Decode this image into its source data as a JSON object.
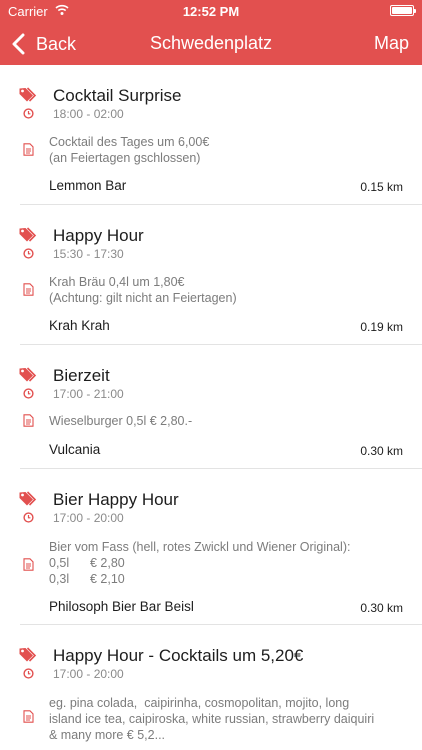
{
  "status_bar": {
    "carrier": "Carrier",
    "time": "12:52 PM"
  },
  "nav": {
    "back_label": "Back",
    "title": "Schwedenplatz",
    "map_label": "Map"
  },
  "colors": {
    "accent": "#e2504f",
    "icon": "#e2504f",
    "secondary_text": "#8a8a8a"
  },
  "icons": {
    "tag": "tag-icon",
    "clock": "clock-icon",
    "description": "document-icon",
    "back": "chevron-left-icon",
    "wifi": "wifi-icon",
    "battery": "battery-icon"
  },
  "deals": [
    {
      "name": "Cocktail Surprise",
      "time": "18:00 - 02:00",
      "description": [
        "Cocktail des Tages um 6,00€",
        "(an Feiertagen gschlossen)"
      ],
      "venue": "Lemmon Bar",
      "distance": "0.15 km"
    },
    {
      "name": "Happy Hour",
      "time": "15:30 - 17:30",
      "description": [
        "Krah Bräu 0,4l um 1,80€",
        "(Achtung: gilt nicht an Feiertagen)"
      ],
      "venue": "Krah Krah",
      "distance": "0.19 km"
    },
    {
      "name": "Bierzeit",
      "time": "17:00 - 21:00",
      "description": [
        "Wieselburger 0,5l € 2,80.-"
      ],
      "venue": "Vulcania",
      "distance": "0.30 km"
    },
    {
      "name": "Bier Happy Hour",
      "time": "17:00 - 20:00",
      "description": [
        "Bier vom Fass (hell, rotes Zwickl und Wiener Original):",
        "0,5l      € 2,80",
        "0,3l      € 2,10"
      ],
      "venue": "Philosoph Bier Bar Beisl",
      "distance": "0.30 km"
    },
    {
      "name": "Happy Hour - Cocktails um 5,20€",
      "time": "17:00 - 20:00",
      "description": [
        "eg. pina colada,  caipirinha, cosmopolitan, mojito, long",
        "island ice tea, caipiroska, white russian, strawberry daiquiri",
        "& many more € 5,2..."
      ],
      "venue": "",
      "distance": ""
    }
  ]
}
